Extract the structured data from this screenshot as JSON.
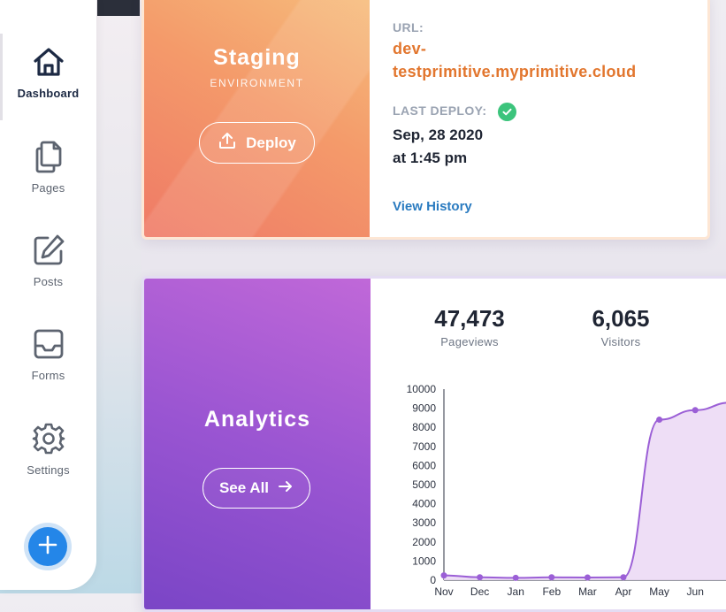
{
  "sidebar": {
    "items": [
      {
        "label": "Dashboard",
        "icon": "home-icon"
      },
      {
        "label": "Pages",
        "icon": "pages-icon"
      },
      {
        "label": "Posts",
        "icon": "edit-icon"
      },
      {
        "label": "Forms",
        "icon": "inbox-icon"
      },
      {
        "label": "Settings",
        "icon": "gear-icon"
      }
    ],
    "add_icon": "plus-icon"
  },
  "staging": {
    "title": "Staging",
    "subtitle": "ENVIRONMENT",
    "deploy_label": "Deploy",
    "url_label": "URL:",
    "url": "dev-testprimitive.myprimitive.cloud",
    "url_line1": "dev-",
    "url_line2": "testprimitive.myprimitive.cloud",
    "last_deploy_label": "LAST DEPLOY:",
    "last_deploy_date": "Sep, 28 2020",
    "last_deploy_time": "at 1:45 pm",
    "history_link": "View History"
  },
  "analytics": {
    "title": "Analytics",
    "see_all_label": "See All",
    "pageviews": {
      "value": "47,473",
      "label": "Pageviews"
    },
    "visitors": {
      "value": "6,065",
      "label": "Visitors"
    }
  },
  "colors": {
    "accent": "#2486e8",
    "url": "#e2762e",
    "link": "#2a7bc0",
    "success": "#3cc47c",
    "chart_line": "#9b5fd6",
    "chart_fill": "#ecdaf5"
  },
  "chart_data": {
    "type": "area",
    "x": [
      "Nov",
      "Dec",
      "Jan",
      "Feb",
      "Mar",
      "Apr",
      "May",
      "Jun"
    ],
    "values": [
      250,
      150,
      120,
      150,
      140,
      150,
      8400,
      8900,
      9300
    ],
    "yticks": [
      0,
      1000,
      2000,
      3000,
      4000,
      5000,
      6000,
      7000,
      8000,
      9000,
      10000
    ],
    "ylim": [
      0,
      10000
    ]
  }
}
